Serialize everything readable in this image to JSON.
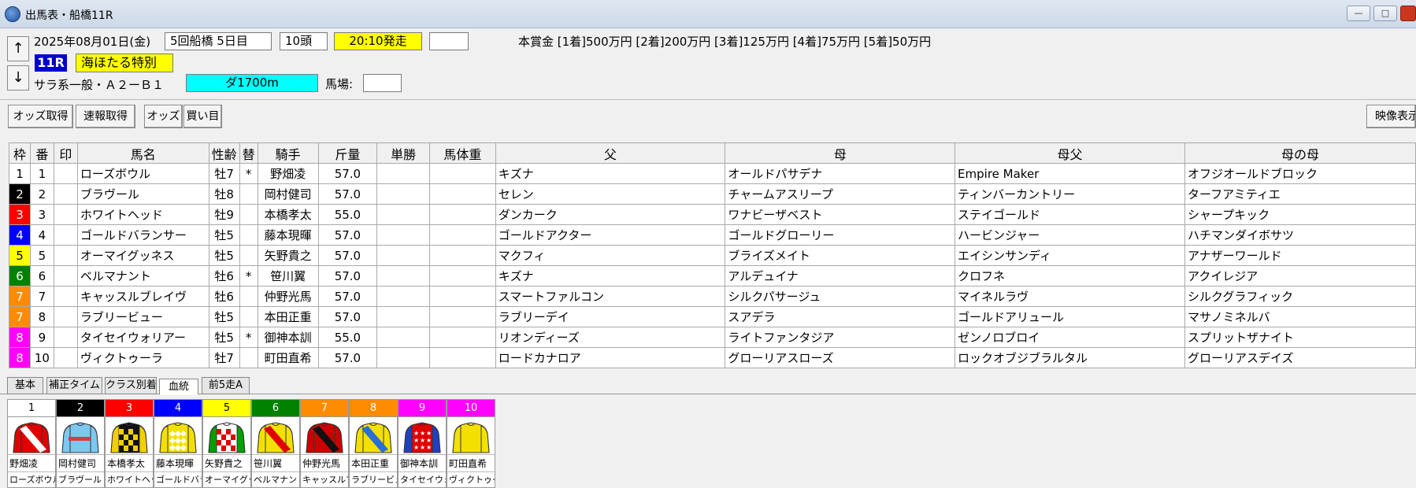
{
  "window": {
    "title": "出馬表・船橋11R",
    "minimize": "—",
    "maximize": "□"
  },
  "header": {
    "date": "2025年08月01日(金)",
    "meeting": "5回船橋 5日目",
    "runners": "10頭",
    "start_time": "20:10発走",
    "blank": "",
    "race_no": "11R",
    "race_name": "海ほたる特別",
    "class": "サラ系一般・Ａ２ーＢ１",
    "distance": "ダ1700m",
    "track_label": "馬場:",
    "track_value": "",
    "prize": "本賞金 [1着]500万円 [2着]200万円 [3着]125万円 [4着]75万円 [5着]50万円",
    "up_arrow": "↑",
    "down_arrow": "↓"
  },
  "toolbar": {
    "odds_fetch": "オッズ取得",
    "flash_fetch": "速報取得",
    "odds": "オッズ",
    "bet": "買い目",
    "video": "映像表示"
  },
  "table": {
    "headers": [
      "枠",
      "番",
      "印",
      "馬名",
      "性齢",
      "替",
      "騎手",
      "斤量",
      "単勝",
      "馬体重",
      "父",
      "母",
      "母父",
      "母の母"
    ],
    "rows": [
      {
        "waku": "1",
        "num": "1",
        "mark": "",
        "name": "ローズボウル",
        "sexage": "牡7",
        "change": "*",
        "jockey": "野畑凌",
        "weight": "57.0",
        "win": "",
        "bw": "",
        "sire": "キズナ",
        "dam": "オールドパサデナ",
        "damsire": "Empire Maker",
        "damdam": "オフジオールドブロック",
        "color": "#ffffff",
        "text": "#000000"
      },
      {
        "waku": "2",
        "num": "2",
        "mark": "",
        "name": "ブラヴール",
        "sexage": "牡8",
        "change": "",
        "jockey": "岡村健司",
        "weight": "57.0",
        "win": "",
        "bw": "",
        "sire": "セレン",
        "dam": "チャームアスリープ",
        "damsire": "ティンバーカントリー",
        "damdam": "ターフアミティエ",
        "color": "#000000",
        "text": "#ffffff"
      },
      {
        "waku": "3",
        "num": "3",
        "mark": "",
        "name": "ホワイトヘッド",
        "sexage": "牡9",
        "change": "",
        "jockey": "本橋孝太",
        "weight": "55.0",
        "win": "",
        "bw": "",
        "sire": "ダンカーク",
        "dam": "ワナビーザベスト",
        "damsire": "ステイゴールド",
        "damdam": "シャープキック",
        "color": "#ff0000",
        "text": "#ffffff"
      },
      {
        "waku": "4",
        "num": "4",
        "mark": "",
        "name": "ゴールドバランサー",
        "sexage": "牡5",
        "change": "",
        "jockey": "藤本現暉",
        "weight": "57.0",
        "win": "",
        "bw": "",
        "sire": "ゴールドアクター",
        "dam": "ゴールドグローリー",
        "damsire": "ハービンジャー",
        "damdam": "ハチマンダイボサツ",
        "color": "#0000ff",
        "text": "#ffffff"
      },
      {
        "waku": "5",
        "num": "5",
        "mark": "",
        "name": "オーマイグッネス",
        "sexage": "牡5",
        "change": "",
        "jockey": "矢野貴之",
        "weight": "57.0",
        "win": "",
        "bw": "",
        "sire": "マクフィ",
        "dam": "ブライズメイト",
        "damsire": "エイシンサンディ",
        "damdam": "アナザーワールド",
        "color": "#ffff00",
        "text": "#000000"
      },
      {
        "waku": "6",
        "num": "6",
        "mark": "",
        "name": "ベルマナント",
        "sexage": "牡6",
        "change": "*",
        "jockey": "笹川翼",
        "weight": "57.0",
        "win": "",
        "bw": "",
        "sire": "キズナ",
        "dam": "アルデュイナ",
        "damsire": "クロフネ",
        "damdam": "アクイレジア",
        "color": "#008000",
        "text": "#ffffff"
      },
      {
        "waku": "7",
        "num": "7",
        "mark": "",
        "name": "キャッスルブレイヴ",
        "sexage": "牡6",
        "change": "",
        "jockey": "仲野光馬",
        "weight": "57.0",
        "win": "",
        "bw": "",
        "sire": "スマートファルコン",
        "dam": "シルクパサージュ",
        "damsire": "マイネルラヴ",
        "damdam": "シルクグラフィック",
        "color": "#ff8c00",
        "text": "#ffffff"
      },
      {
        "waku": "7",
        "num": "8",
        "mark": "",
        "name": "ラブリービュー",
        "sexage": "牡5",
        "change": "",
        "jockey": "本田正重",
        "weight": "57.0",
        "win": "",
        "bw": "",
        "sire": "ラブリーデイ",
        "dam": "スアデラ",
        "damsire": "ゴールドアリュール",
        "damdam": "マサノミネルバ",
        "color": "#ff8c00",
        "text": "#ffffff"
      },
      {
        "waku": "8",
        "num": "9",
        "mark": "",
        "name": "タイセイウォリアー",
        "sexage": "牡5",
        "change": "*",
        "jockey": "御神本訓",
        "weight": "55.0",
        "win": "",
        "bw": "",
        "sire": "リオンディーズ",
        "dam": "ライトファンタジア",
        "damsire": "ゼンノロブロイ",
        "damdam": "スプリットザナイト",
        "color": "#ff00ff",
        "text": "#ffffff"
      },
      {
        "waku": "8",
        "num": "10",
        "mark": "",
        "name": "ヴィクトゥーラ",
        "sexage": "牡7",
        "change": "",
        "jockey": "町田直希",
        "weight": "57.0",
        "win": "",
        "bw": "",
        "sire": "ロードカナロア",
        "dam": "グローリアスローズ",
        "damsire": "ロックオブジブラルタル",
        "damdam": "グローリアスデイズ",
        "color": "#ff00ff",
        "text": "#ffffff"
      }
    ]
  },
  "tabs": [
    "基本",
    "補正タイム",
    "クラス別着",
    "血統",
    "前5走A"
  ],
  "silks": [
    {
      "num": "1",
      "jockey": "野畑凌",
      "horse": "ローズボウル",
      "bg": "#ffffff",
      "numcolor": "#000000",
      "body": "#e00000",
      "stripe": "#ffffff",
      "sleeve": "#e00000",
      "pattern": "sash"
    },
    {
      "num": "2",
      "jockey": "岡村健司",
      "horse": "ブラヴール",
      "bg": "#000000",
      "numcolor": "#ffffff",
      "body": "#7ec8f0",
      "stripe": "#d04040",
      "sleeve": "#7ec8f0",
      "pattern": "hoop"
    },
    {
      "num": "3",
      "jockey": "本橋孝太",
      "horse": "ホワイトヘッド",
      "bg": "#ff0000",
      "numcolor": "#ffffff",
      "body": "#111111",
      "stripe": "#f0d000",
      "sleeve": "#f0d000",
      "pattern": "check"
    },
    {
      "num": "4",
      "jockey": "藤本現暉",
      "horse": "ゴールドバランサー",
      "bg": "#0000ff",
      "numcolor": "#ffffff",
      "body": "#f3e000",
      "stripe": "#ffffff",
      "sleeve": "#f3e000",
      "pattern": "diamond"
    },
    {
      "num": "5",
      "jockey": "矢野貴之",
      "horse": "オーマイグッネス",
      "bg": "#ffff00",
      "numcolor": "#000000",
      "body": "#ffffff",
      "stripe": "#e00000",
      "sleeve": "#00a000",
      "pattern": "check"
    },
    {
      "num": "6",
      "jockey": "笹川翼",
      "horse": "ベルマナント",
      "bg": "#008000",
      "numcolor": "#ffffff",
      "body": "#f3e000",
      "stripe": "#e00000",
      "sleeve": "#f3e000",
      "pattern": "sash"
    },
    {
      "num": "7",
      "jockey": "仲野光馬",
      "horse": "キャッスルブレイヴ",
      "bg": "#ff8c00",
      "numcolor": "#ffffff",
      "body": "#cc0000",
      "stripe": "#111111",
      "sleeve": "#cc0000",
      "pattern": "sash"
    },
    {
      "num": "8",
      "jockey": "本田正重",
      "horse": "ラブリービュー",
      "bg": "#ff8c00",
      "numcolor": "#ffffff",
      "body": "#f3e000",
      "stripe": "#2a6fd6",
      "sleeve": "#f3e000",
      "pattern": "sash"
    },
    {
      "num": "9",
      "jockey": "御神本訓",
      "horse": "タイセイウォリアー",
      "bg": "#ff00ff",
      "numcolor": "#ffffff",
      "body": "#e00000",
      "stripe": "#2040c0",
      "sleeve": "#2040c0",
      "pattern": "stars"
    },
    {
      "num": "10",
      "jockey": "町田直希",
      "horse": "ヴィクトゥーラ",
      "bg": "#ff00ff",
      "numcolor": "#ffffff",
      "body": "#f3e000",
      "stripe": "#f3e000",
      "sleeve": "#f3e000",
      "pattern": "plain"
    }
  ]
}
